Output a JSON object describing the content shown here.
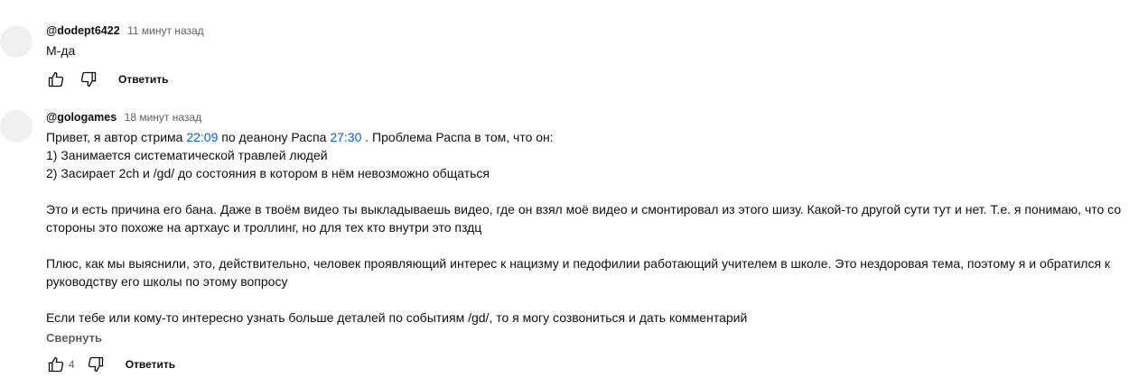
{
  "comments": [
    {
      "author": "@dodept6422",
      "time": "11 минут назад",
      "text": "М-да",
      "reply_label": "Ответить",
      "like_icon": "thumb-up-icon",
      "dislike_icon": "thumb-down-icon"
    },
    {
      "author": "@gologames",
      "time": "18 минут назад",
      "line1": {
        "a": "Привет, я автор стрима ",
        "ts1": "22:09",
        "b": " по деанону Распа ",
        "ts2": "27:30",
        "c": " . Проблема Распа в том, что он:"
      },
      "line2": "1) Занимается систематической травлей людей",
      "line3": "2) Засирает 2ch и /gd/ до состояния в котором в нём невозможно общаться",
      "para2": "Это и есть причина его бана. Даже в твоём видео ты выкладываешь видео, где он взял моё видео и смонтировал из этого шизу. Какой-то другой сути тут и нет. Т.е. я понимаю, что со стороны это похоже на артхаус и троллинг, но для тех кто внутри это пздц",
      "para3": "Плюс, как мы выяснили, это, действительно, человек проявляющий интерес к нацизму и педофилии работающий учителем в школе. Это нездоровая тема, поэтому я и обратился к руководству его школы по этому вопросу",
      "para4": "Если тебе или кому-то интересно узнать больше деталей по событиям /gd/, то я могу созвониться и дать комментарий",
      "collapse_label": "Свернуть",
      "like_count": "4",
      "reply_label": "Ответить",
      "like_icon": "thumb-up-icon",
      "dislike_icon": "thumb-down-icon"
    }
  ],
  "colors": {
    "timestamp_link": "#065fd4",
    "secondary_text": "#606060",
    "avatar_placeholder": "#f0f0f0"
  }
}
